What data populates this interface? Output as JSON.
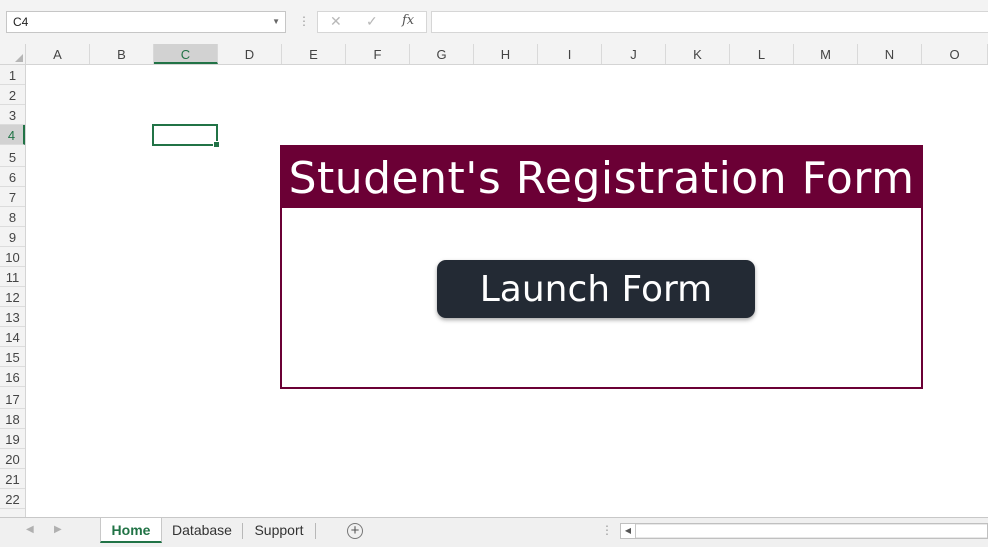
{
  "formula_bar": {
    "name_box": "C4",
    "cancel_icon": "✕",
    "enter_icon": "✓",
    "fx_label": "fx",
    "formula_value": ""
  },
  "columns": [
    "A",
    "B",
    "C",
    "D",
    "E",
    "F",
    "G",
    "H",
    "I",
    "J",
    "K",
    "L",
    "M",
    "N",
    "O"
  ],
  "selected_column": "C",
  "rows": [
    "1",
    "2",
    "3",
    "4",
    "5",
    "6",
    "7",
    "8",
    "9",
    "10",
    "11",
    "12",
    "13",
    "14",
    "15",
    "16",
    "17",
    "18",
    "19",
    "20",
    "21",
    "22"
  ],
  "selected_row": "4",
  "form": {
    "title": "Student's Registration Form",
    "button_label": "Launch Form",
    "accent_color": "#6b0035",
    "button_color": "#232a34"
  },
  "sheets": {
    "tabs": [
      {
        "label": "Home",
        "active": true
      },
      {
        "label": "Database",
        "active": false
      },
      {
        "label": "Support",
        "active": false
      }
    ],
    "add_sheet_icon": "+"
  },
  "accent": "#217346"
}
